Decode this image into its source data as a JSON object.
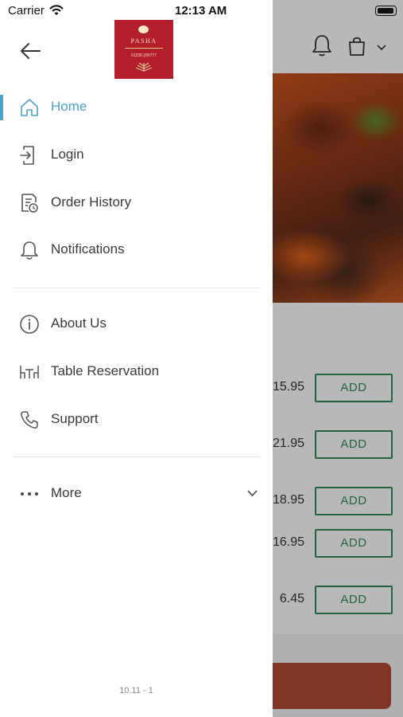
{
  "status_bar": {
    "carrier": "Carrier",
    "time": "12:13 AM"
  },
  "drawer": {
    "logo": {
      "name": "PASHA",
      "phone": "01226 295777"
    },
    "primary_items": [
      {
        "label": "Home",
        "icon": "home-icon",
        "active": true
      },
      {
        "label": "Login",
        "icon": "login-icon"
      },
      {
        "label": "Order History",
        "icon": "order-history-icon"
      },
      {
        "label": "Notifications",
        "icon": "bell-icon"
      }
    ],
    "secondary_items": [
      {
        "label": "About Us",
        "icon": "info-icon"
      },
      {
        "label": "Table Reservation",
        "icon": "table-icon"
      },
      {
        "label": "Support",
        "icon": "phone-icon"
      }
    ],
    "more": {
      "label": "More",
      "icon": "ellipsis-icon"
    },
    "version": "10.11 - 1"
  },
  "background": {
    "menu_prices": [
      {
        "price": "15.95",
        "button": "ADD"
      },
      {
        "price": "21.95",
        "button": "ADD"
      },
      {
        "price": "18.95",
        "button": "ADD"
      },
      {
        "price": "16.95",
        "button": "ADD"
      },
      {
        "price": "6.45",
        "button": "ADD"
      }
    ]
  },
  "colors": {
    "accent": "#4aa3c8",
    "add_button": "#2e8b57",
    "logo_bg": "#b21e2a",
    "cta": "#b24a33"
  }
}
